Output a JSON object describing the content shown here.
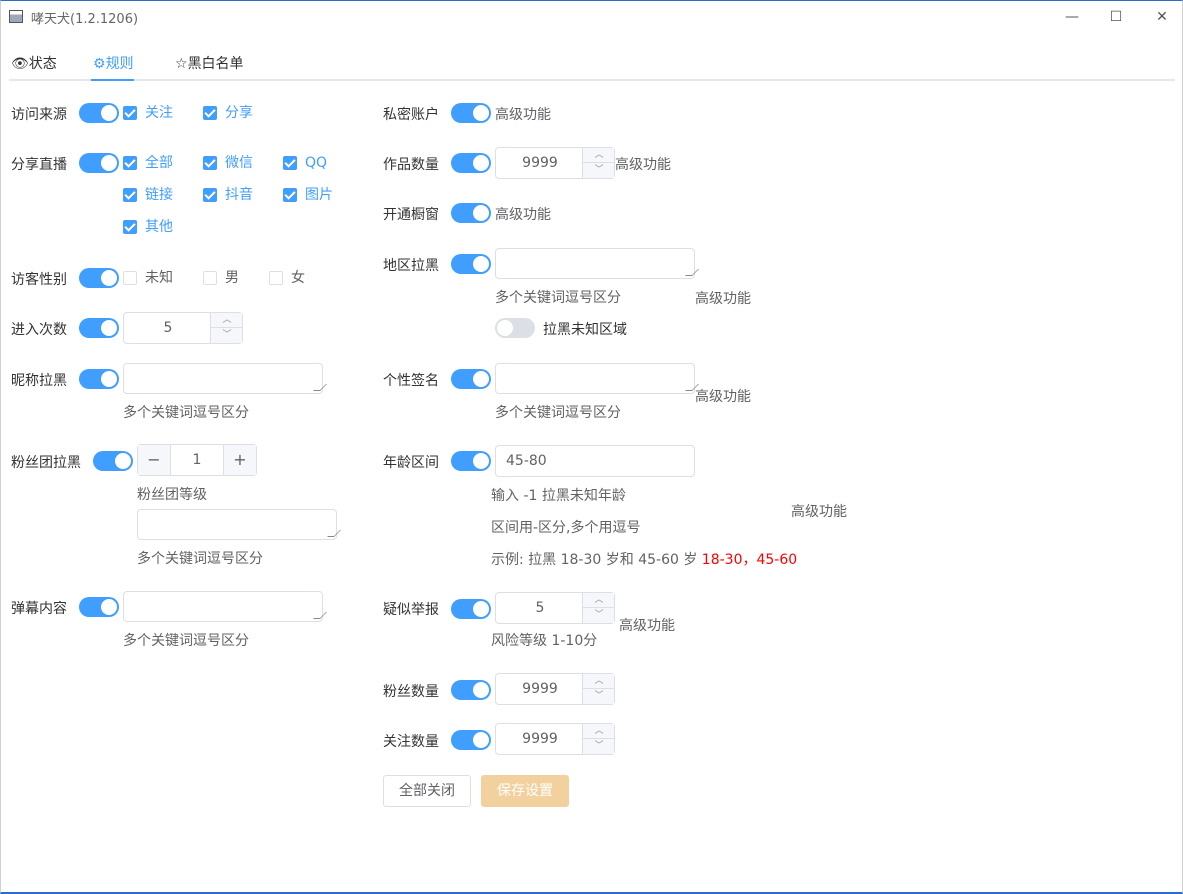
{
  "window": {
    "title": "哮天犬(1.2.1206)",
    "minimize": "—",
    "maximize": "☐",
    "close": "✕"
  },
  "tabs": [
    {
      "label": "状态",
      "icon": "eye-icon",
      "glyph": "👁"
    },
    {
      "label": "规则",
      "icon": "gear-icon",
      "glyph": "⚙"
    },
    {
      "label": "黑白名单",
      "icon": "star-icon",
      "glyph": "☆"
    }
  ],
  "left": {
    "source": {
      "label": "访问来源",
      "on": true,
      "opts": [
        "关注",
        "分享"
      ]
    },
    "share_live": {
      "label": "分享直播",
      "on": true,
      "opts": [
        "全部",
        "微信",
        "QQ",
        "链接",
        "抖音",
        "图片",
        "其他"
      ]
    },
    "gender": {
      "label": "访客性别",
      "on": true,
      "opts": [
        "未知",
        "男",
        "女"
      ]
    },
    "visits": {
      "label": "进入次数",
      "on": true,
      "value": "5"
    },
    "nickname": {
      "label": "昵称拉黑",
      "on": true,
      "hint": "多个关键词逗号区分"
    },
    "fans_club": {
      "label": "粉丝团拉黑",
      "on": true,
      "value": "1",
      "minus": "−",
      "plus": "+",
      "level_hint": "粉丝团等级",
      "hint": "多个关键词逗号区分"
    },
    "danmu": {
      "label": "弹幕内容",
      "on": true,
      "hint": "多个关键词逗号区分"
    }
  },
  "right": {
    "private": {
      "label": "私密账户",
      "on": true,
      "adv": "高级功能"
    },
    "works": {
      "label": "作品数量",
      "on": true,
      "value": "9999",
      "adv": "高级功能"
    },
    "shop": {
      "label": "开通橱窗",
      "on": true,
      "adv": "高级功能"
    },
    "region": {
      "label": "地区拉黑",
      "on": true,
      "hint": "多个关键词逗号区分",
      "adv": "高级功能",
      "unknown_label": "拉黑未知区域",
      "unknown_on": false
    },
    "signature": {
      "label": "个性签名",
      "on": true,
      "hint": "多个关键词逗号区分",
      "adv": "高级功能"
    },
    "age": {
      "label": "年龄区间",
      "on": true,
      "value": "45-80",
      "hint1": "输入 -1 拉黑未知年龄",
      "hint2": "区间用-区分,多个用逗号",
      "hint3": "示例: 拉黑 18-30 岁和 45-60 岁",
      "example": "18-30，45-60",
      "adv": "高级功能"
    },
    "report": {
      "label": "疑似举报",
      "on": true,
      "value": "5",
      "hint": "风险等级 1-10分",
      "adv": "高级功能"
    },
    "fans": {
      "label": "粉丝数量",
      "on": true,
      "value": "9999"
    },
    "follow": {
      "label": "关注数量",
      "on": true,
      "value": "9999"
    }
  },
  "buttons": {
    "close_all": "全部关闭",
    "save": "保存设置"
  },
  "colors": {
    "primary": "#409eff",
    "warning_light": "#f3d19e",
    "title_border": "#2b6cc4"
  }
}
